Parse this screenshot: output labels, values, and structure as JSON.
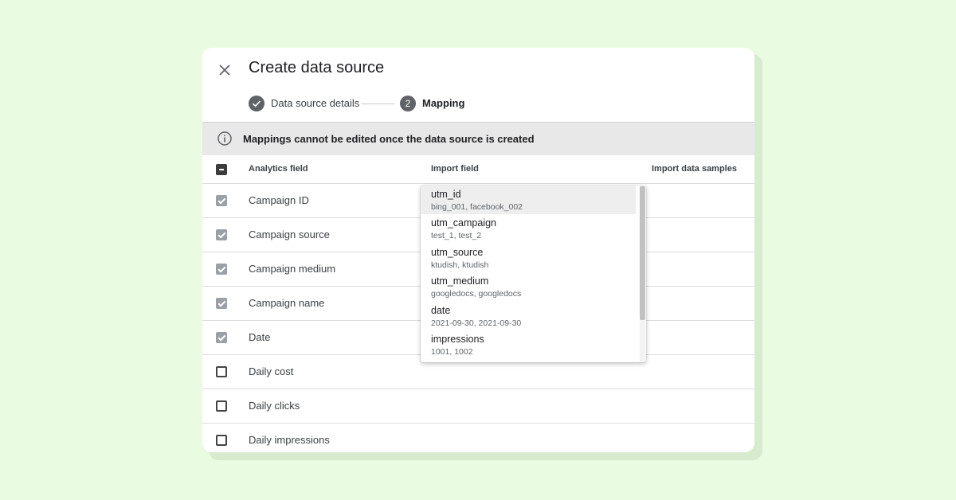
{
  "dialog": {
    "title": "Create data source",
    "close_icon": "close-icon"
  },
  "stepper": {
    "steps": [
      {
        "label": "Data source details",
        "state": "completed",
        "icon": "check-icon"
      },
      {
        "label": "Mapping",
        "state": "active",
        "number": "2"
      }
    ]
  },
  "banner": {
    "icon": "info-icon",
    "text": "Mappings cannot be edited once the data source is created"
  },
  "table": {
    "headers": {
      "analytics_field": "Analytics field",
      "import_field": "Import field",
      "import_samples": "Import data samples"
    },
    "select_all_state": "indeterminate",
    "rows": [
      {
        "label": "Campaign ID",
        "checked": true
      },
      {
        "label": "Campaign source",
        "checked": true
      },
      {
        "label": "Campaign medium",
        "checked": true
      },
      {
        "label": "Campaign name",
        "checked": true
      },
      {
        "label": "Date",
        "checked": true
      },
      {
        "label": "Daily cost",
        "checked": false
      },
      {
        "label": "Daily clicks",
        "checked": false
      },
      {
        "label": "Daily impressions",
        "checked": false
      }
    ]
  },
  "dropdown": {
    "options": [
      {
        "name": "utm_id",
        "samples": "bing_001, facebook_002",
        "selected": true
      },
      {
        "name": "utm_campaign",
        "samples": "test_1, test_2",
        "selected": false
      },
      {
        "name": "utm_source",
        "samples": "ktudish, ktudish",
        "selected": false
      },
      {
        "name": "utm_medium",
        "samples": "googledocs, googledocs",
        "selected": false
      },
      {
        "name": "date",
        "samples": "2021-09-30, 2021-09-30",
        "selected": false
      },
      {
        "name": "impressions",
        "samples": "1001, 1002",
        "selected": false
      }
    ]
  },
  "colors": {
    "page_background": "#e9fbe0",
    "banner_background": "#e8e8e8",
    "step_circle": "#5f6368",
    "checked_checkbox": "#9aa0a6"
  }
}
